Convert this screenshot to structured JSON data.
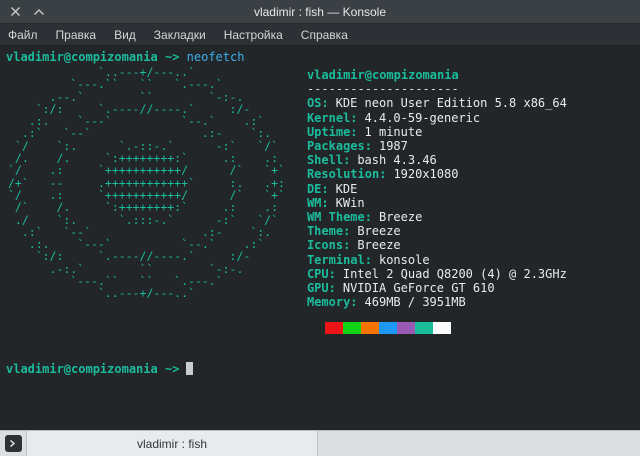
{
  "window": {
    "title": "vladimir : fish — Konsole"
  },
  "menu": {
    "items": [
      "Файл",
      "Правка",
      "Вид",
      "Закладки",
      "Настройка",
      "Справка"
    ]
  },
  "terminal": {
    "prompt": {
      "user_host": "vladimir@compizomania",
      "symbol": "~>",
      "command": "neofetch"
    },
    "ascii_art": "             `..---+/---..`\n         `---.``   ``   `.---.`\n      .--.`        ``        `-:-.\n    `:/:     `.----//----.`     :/-\n   .:.    `---`          `--.`    .:`\n  .:`   `--`                .:-    `:.\n `/    `:.      `.-::-.`      -:`   `/`\n /.    /.     `:++++++++:`     .:    .:\n`/    .:     `+++++++++++/      /`   `+`\n/+`   --     .++++++++++++`     :.   .+:\n`/    .:     `+++++++++++/      /`   `+`\n /`    /.     `:++++++++:`     .:    .:\n ./    `:.      `.:::-.`      -:`   `/`\n  .:`   `--`                .:-    `:.\n   .:.    `---`          `--.`    .:`\n    `:/:     `.----//----.`     :/-\n      .-:.`        ``        `-:-.\n         `---.``   ``   `.---.`\n             `..---+/---..`",
    "neofetch": {
      "header": "vladimir@compizomania",
      "separator": "---------------------",
      "rows": [
        {
          "label": "OS:",
          "value": "KDE neon User Edition 5.8 x86_64"
        },
        {
          "label": "Kernel:",
          "value": "4.4.0-59-generic"
        },
        {
          "label": "Uptime:",
          "value": "1 minute"
        },
        {
          "label": "Packages:",
          "value": "1987"
        },
        {
          "label": "Shell:",
          "value": "bash 4.3.46"
        },
        {
          "label": "Resolution:",
          "value": "1920x1080"
        },
        {
          "label": "DE:",
          "value": "KDE"
        },
        {
          "label": "WM:",
          "value": "KWin"
        },
        {
          "label": "WM Theme:",
          "value": "Breeze"
        },
        {
          "label": "Theme:",
          "value": "Breeze"
        },
        {
          "label": "Icons:",
          "value": "Breeze"
        },
        {
          "label": "Terminal:",
          "value": "konsole"
        },
        {
          "label": "CPU:",
          "value": "Intel 2 Quad Q8200 (4) @ 2.3GHz"
        },
        {
          "label": "GPU:",
          "value": "NVIDIA GeForce GT 610"
        },
        {
          "label": "Memory:",
          "value": "469MB / 3951MB"
        }
      ],
      "palette": [
        "#232627",
        "#ed1515",
        "#11d116",
        "#f67400",
        "#1d99f3",
        "#9b59b6",
        "#1abc9c",
        "#fcfcfc"
      ]
    }
  },
  "tabbar": {
    "tab_label": "vladimir : fish"
  },
  "colors": {
    "accent_teal": "#1abc9c",
    "command_blue": "#3daee9",
    "terminal_bg": "#232629",
    "foreground": "#eff0f1"
  }
}
